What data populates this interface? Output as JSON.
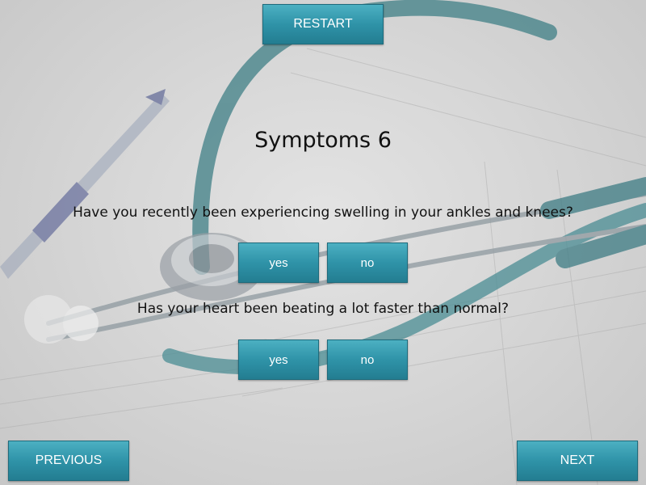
{
  "nav": {
    "restart_label": "RESTART",
    "previous_label": "PREVIOUS",
    "next_label": "NEXT"
  },
  "page": {
    "title": "Symptoms 6"
  },
  "questions": [
    {
      "text": "Have you recently been experiencing swelling in your ankles and knees?",
      "yes_label": "yes",
      "no_label": "no"
    },
    {
      "text": "Has your heart been beating a lot faster than normal?",
      "yes_label": "yes",
      "no_label": "no"
    }
  ],
  "colors": {
    "button": "#2f93a8",
    "button_border": "#1f6b7c",
    "button_text": "#ffffff",
    "text": "#111111"
  },
  "background": {
    "image": "stethoscope-and-pen-on-form"
  }
}
